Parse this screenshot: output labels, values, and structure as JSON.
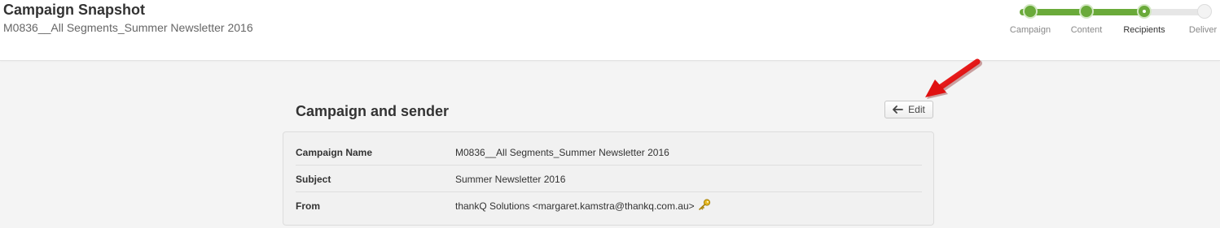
{
  "header": {
    "title": "Campaign Snapshot",
    "subtitle": "M0836__All Segments_Summer Newsletter 2016"
  },
  "stepper": {
    "steps": [
      {
        "label": "Campaign",
        "state": "done"
      },
      {
        "label": "Content",
        "state": "done"
      },
      {
        "label": "Recipients",
        "state": "current"
      },
      {
        "label": "Deliver",
        "state": "todo"
      }
    ],
    "progress_color": "#6aaa3a"
  },
  "section": {
    "title": "Campaign and sender",
    "edit_label": "Edit",
    "edit_icon": "arrow-left-icon"
  },
  "details": {
    "rows": [
      {
        "label": "Campaign Name",
        "value": "M0836__All Segments_Summer Newsletter 2016"
      },
      {
        "label": "Subject",
        "value": "Summer Newsletter 2016"
      },
      {
        "label": "From",
        "value": "thankQ Solutions <margaret.kamstra@thankq.com.au>",
        "icon": "key-icon"
      }
    ]
  },
  "annotation": {
    "arrow_color": "#e01010",
    "icon": "red-arrow-icon"
  }
}
